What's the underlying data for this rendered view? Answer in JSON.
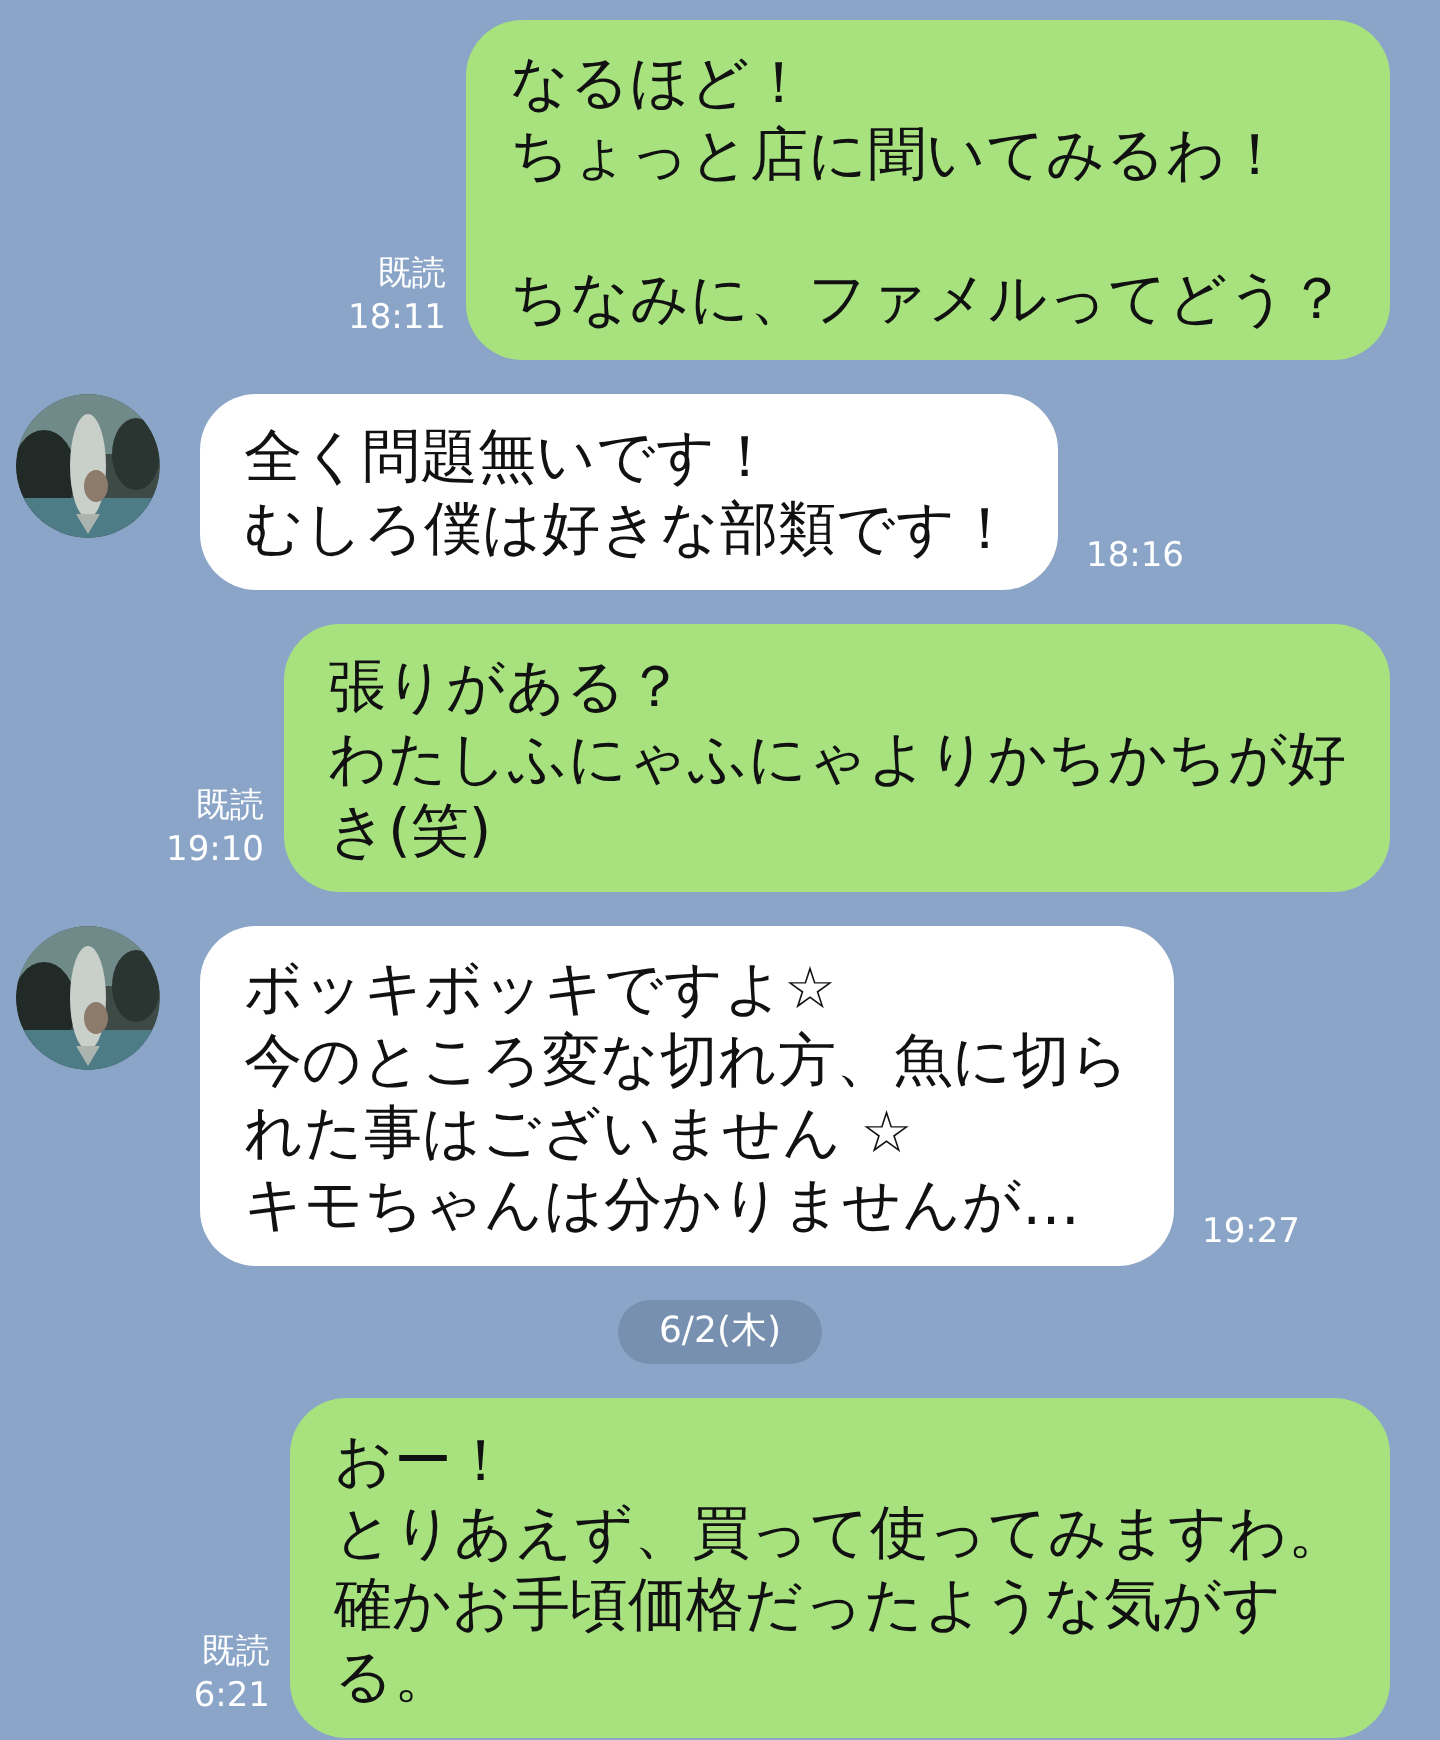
{
  "messages": [
    {
      "kind": "outgoing",
      "paragraphs": [
        [
          "なるほど！",
          "ちょっと店に聞いてみるわ！"
        ],
        [
          "ちなみに、ファメルってどう？"
        ]
      ],
      "read": "既読",
      "time": "18:11"
    },
    {
      "kind": "incoming",
      "avatar": {
        "kind": "picture"
      },
      "paragraphs": [
        [
          "全く問題無いです！",
          "むしろ僕は好きな部類です！"
        ]
      ],
      "time": "18:16"
    },
    {
      "kind": "outgoing",
      "paragraphs": [
        [
          "張りがある？",
          "わたしふにゃふにゃよりかちかちが好",
          "き(笑)"
        ]
      ],
      "read": "既読",
      "time": "19:10"
    },
    {
      "kind": "incoming",
      "avatar": {
        "kind": "picture"
      },
      "paragraphs": [
        [
          "ボッキボッキですよ☆",
          "今のところ変な切れ方、魚に切ら",
          "れた事はございません ☆",
          "キモちゃんは分かりませんが…"
        ]
      ],
      "time": "19:27"
    },
    {
      "kind": "date",
      "label": "6/2(木)"
    },
    {
      "kind": "outgoing",
      "paragraphs": [
        [
          "おー！",
          "とりあえず、買って使ってみますわ。",
          "確かお手頃価格だったような気がす",
          "る。"
        ]
      ],
      "read": "既読",
      "time": "6:21"
    }
  ]
}
